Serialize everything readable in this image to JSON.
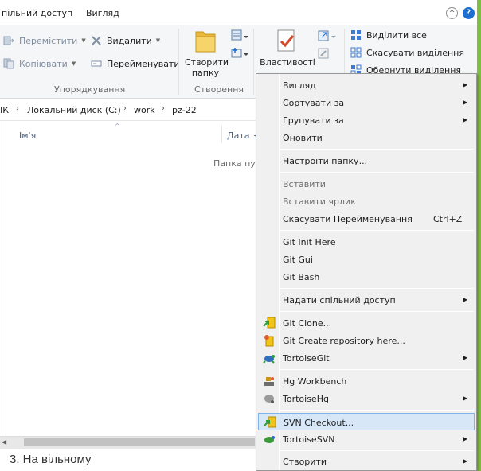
{
  "tabs": {
    "share": "пільний доступ",
    "view": "Вигляд"
  },
  "ribbon": {
    "organize": {
      "move_to": "Перемістити",
      "copy_to": "Копіювати",
      "delete": "Видалити",
      "rename": "Перейменувати",
      "group_label": "Упорядкування"
    },
    "new": {
      "new_folder_line1": "Створити",
      "new_folder_line2": "папку",
      "group_label": "Створення"
    },
    "open": {
      "properties": "Властивості"
    },
    "select": {
      "select_all": "Виділити все",
      "select_none": "Скасувати виділення",
      "invert": "Обернути виділення"
    }
  },
  "address": {
    "crumbs": [
      "ІК",
      "Локальний диск (C:)",
      "work",
      "pz-22"
    ]
  },
  "content": {
    "col_name": "Ім'я",
    "col_date": "Дата зм",
    "empty_text": "Папка пус"
  },
  "document": {
    "text": "3.   На вільному"
  },
  "context_menu": {
    "view": "Вигляд",
    "sort_by": "Сортувати за",
    "group_by": "Групувати за",
    "refresh": "Оновити",
    "customize": "Настроїти папку...",
    "paste": "Вставити",
    "paste_shortcut": "Вставити ярлик",
    "undo_rename": "Скасувати Перейменування",
    "undo_shortcut": "Ctrl+Z",
    "git_init": "Git Init Here",
    "git_gui": "Git Gui",
    "git_bash": "Git Bash",
    "give_access": "Надати спільний доступ",
    "git_clone": "Git Clone...",
    "git_create": "Git Create repository here...",
    "tortoise_git": "TortoiseGit",
    "hg_workbench": "Hg Workbench",
    "tortoise_hg": "TortoiseHg",
    "svn_checkout": "SVN Checkout...",
    "tortoise_svn": "TortoiseSVN",
    "new": "Створити"
  },
  "icons": {
    "submenu_arrow": "▶",
    "caret": "▼",
    "collapse": "^",
    "help": "?",
    "chevron": "›",
    "sort_up": "^"
  },
  "colors": {
    "accent": "#1c6fd0",
    "highlight": "#d7e7f8",
    "green_band": "#7fbf3f"
  }
}
